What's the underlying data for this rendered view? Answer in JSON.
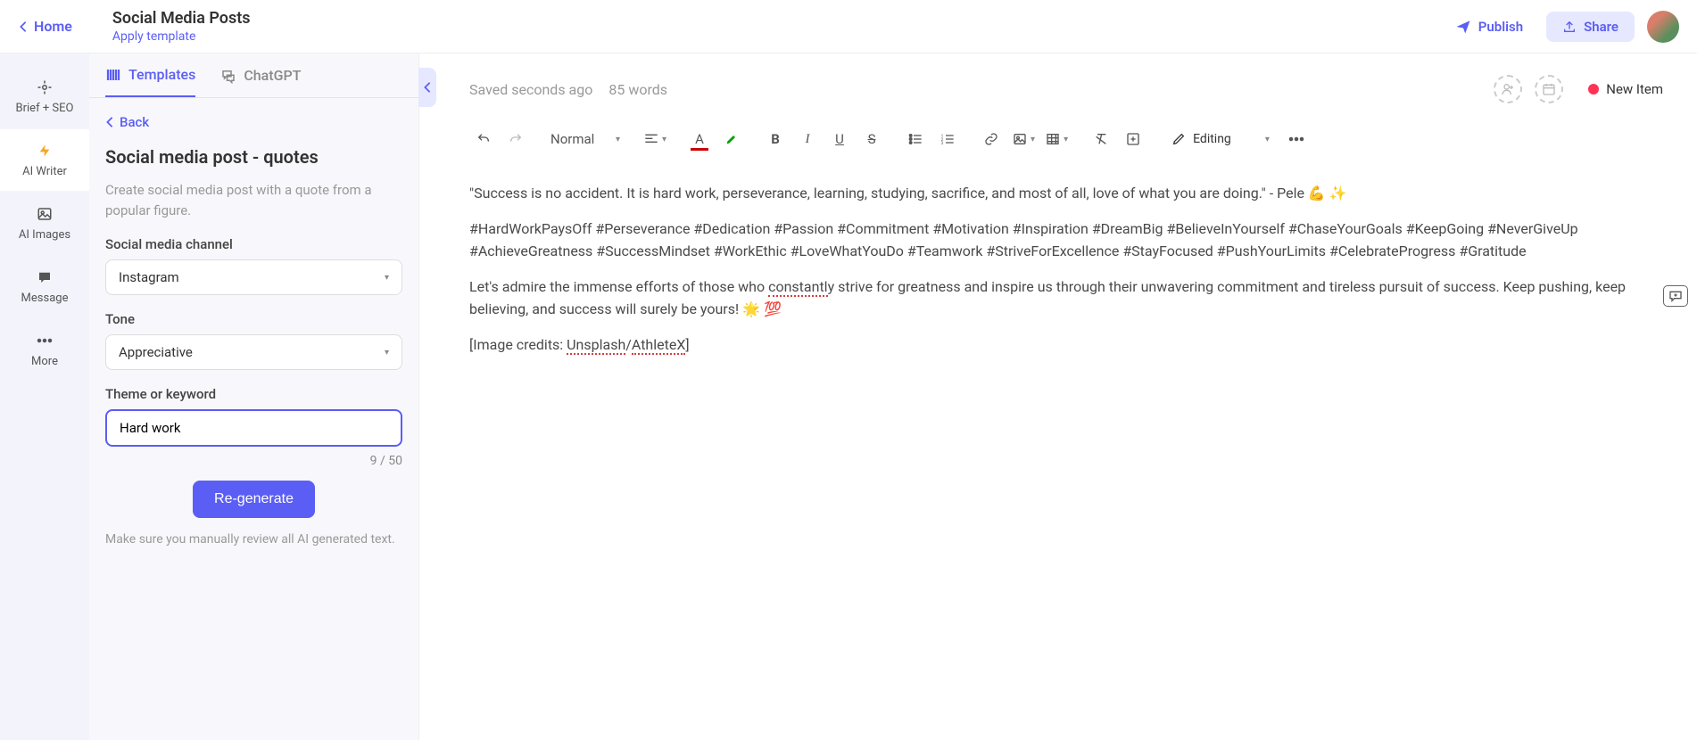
{
  "header": {
    "home": "Home",
    "title": "Social Media Posts",
    "subtitle": "Apply template",
    "publish": "Publish",
    "share": "Share"
  },
  "rail": {
    "items": [
      {
        "key": "brief",
        "label": "Brief + SEO"
      },
      {
        "key": "writer",
        "label": "AI Writer"
      },
      {
        "key": "images",
        "label": "AI Images"
      },
      {
        "key": "message",
        "label": "Message"
      },
      {
        "key": "more",
        "label": "More"
      }
    ]
  },
  "panel": {
    "tabs": {
      "templates": "Templates",
      "chatgpt": "ChatGPT"
    },
    "back": "Back",
    "title": "Social media post - quotes",
    "desc": "Create social media post with a quote from a popular figure.",
    "channel_label": "Social media channel",
    "channel_value": "Instagram",
    "tone_label": "Tone",
    "tone_value": "Appreciative",
    "theme_label": "Theme or keyword",
    "theme_value": "Hard work",
    "char_count": "9 / 50",
    "regenerate": "Re-generate",
    "disclaimer": "Make sure you manually review all AI generated text."
  },
  "editor": {
    "save_status": "Saved seconds ago",
    "word_count": "85 words",
    "new_item": "New Item",
    "style": "Normal",
    "editing_mode": "Editing"
  },
  "content": {
    "quote": "\"Success is no accident. It is hard work, perseverance, learning, studying, sacrifice, and most of all, love of what you are doing.\" - Pele 💪 ✨",
    "hashtags": "#HardWorkPaysOff #Perseverance #Dedication #Passion #Commitment #Motivation #Inspiration #DreamBig #BelieveInYourself #ChaseYourGoals #KeepGoing #NeverGiveUp #AchieveGreatness #SuccessMindset #WorkEthic #LoveWhatYouDo #Teamwork #StriveForExcellence #StayFocused #PushYourLimits #CelebrateProgress #Gratitude",
    "body_pre": "Let's admire the immense efforts of those who ",
    "body_err": "constantl",
    "body_post": "y strive for greatness and inspire us through their unwavering commitment and tireless pursuit of success. Keep pushing, keep believing, and success will surely be yours! 🌟 💯",
    "credits_pre": "[Image credits: ",
    "credits_l1": "Unsplash",
    "credits_sep": "/",
    "credits_l2": "AthleteX",
    "credits_post": "]"
  }
}
